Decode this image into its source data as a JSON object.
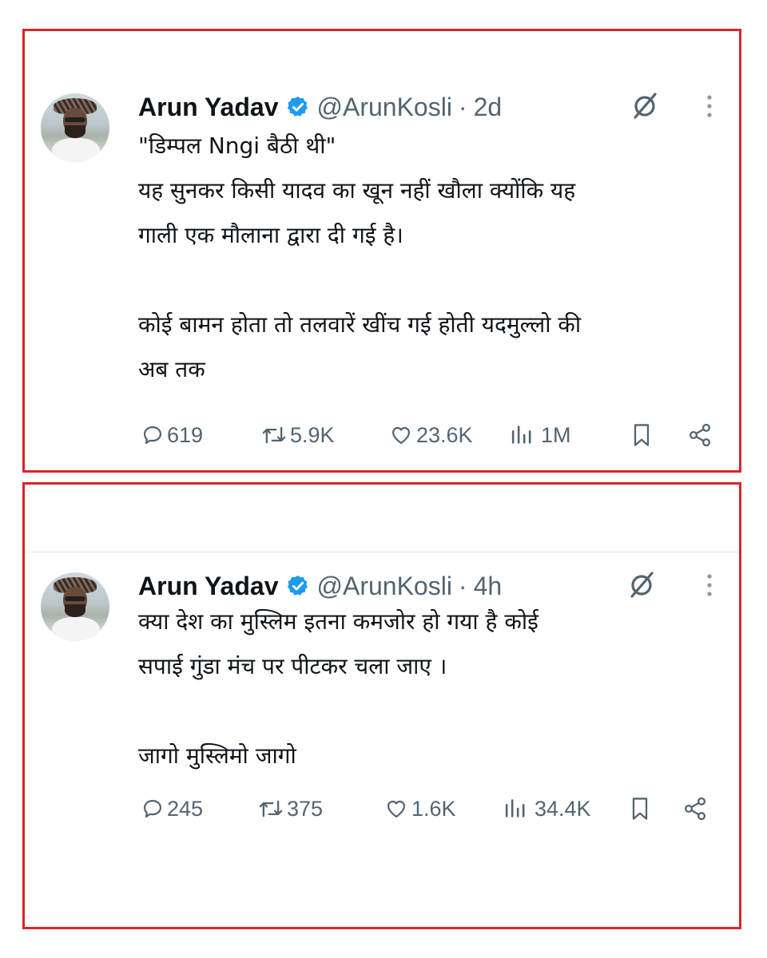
{
  "tweets": [
    {
      "author_name": "Arun Yadav",
      "handle": "@ArunKosli",
      "separator": "·",
      "time": "2d",
      "lines": [
        "\"डिम्पल Nngi बैठी थी\"",
        "यह सुनकर किसी यादव का खून नहीं खौला क्योंकि यह",
        "गाली एक मौलाना द्वारा दी गई है।",
        "",
        "कोई बामन होता तो तलवारें खींच गई होती यदमुल्लो की",
        "अब तक"
      ],
      "stats": {
        "replies": "619",
        "reposts": "5.9K",
        "likes": "23.6K",
        "views": "1M"
      }
    },
    {
      "author_name": "Arun Yadav",
      "handle": "@ArunKosli",
      "separator": "·",
      "time": "4h",
      "lines": [
        "क्या देश का मुस्लिम इतना कमजोर हो गया है कोई",
        "सपाई गुंडा मंच पर पीटकर चला जाए ।",
        "",
        "जागो मुस्लिमो जागो"
      ],
      "stats": {
        "replies": "245",
        "reposts": "375",
        "likes": "1.6K",
        "views": "34.4K"
      }
    }
  ],
  "icons": {
    "verified": "verified-badge-icon",
    "grok": "grok-icon",
    "more": "more-vertical-icon",
    "reply": "reply-icon",
    "repost": "repost-icon",
    "like": "like-icon",
    "views": "views-icon",
    "bookmark": "bookmark-icon",
    "share": "share-icon"
  },
  "colors": {
    "frame_border": "#d7262b",
    "text_primary": "#0f1419",
    "text_secondary": "#536471",
    "verified_blue": "#1d9bf0"
  }
}
